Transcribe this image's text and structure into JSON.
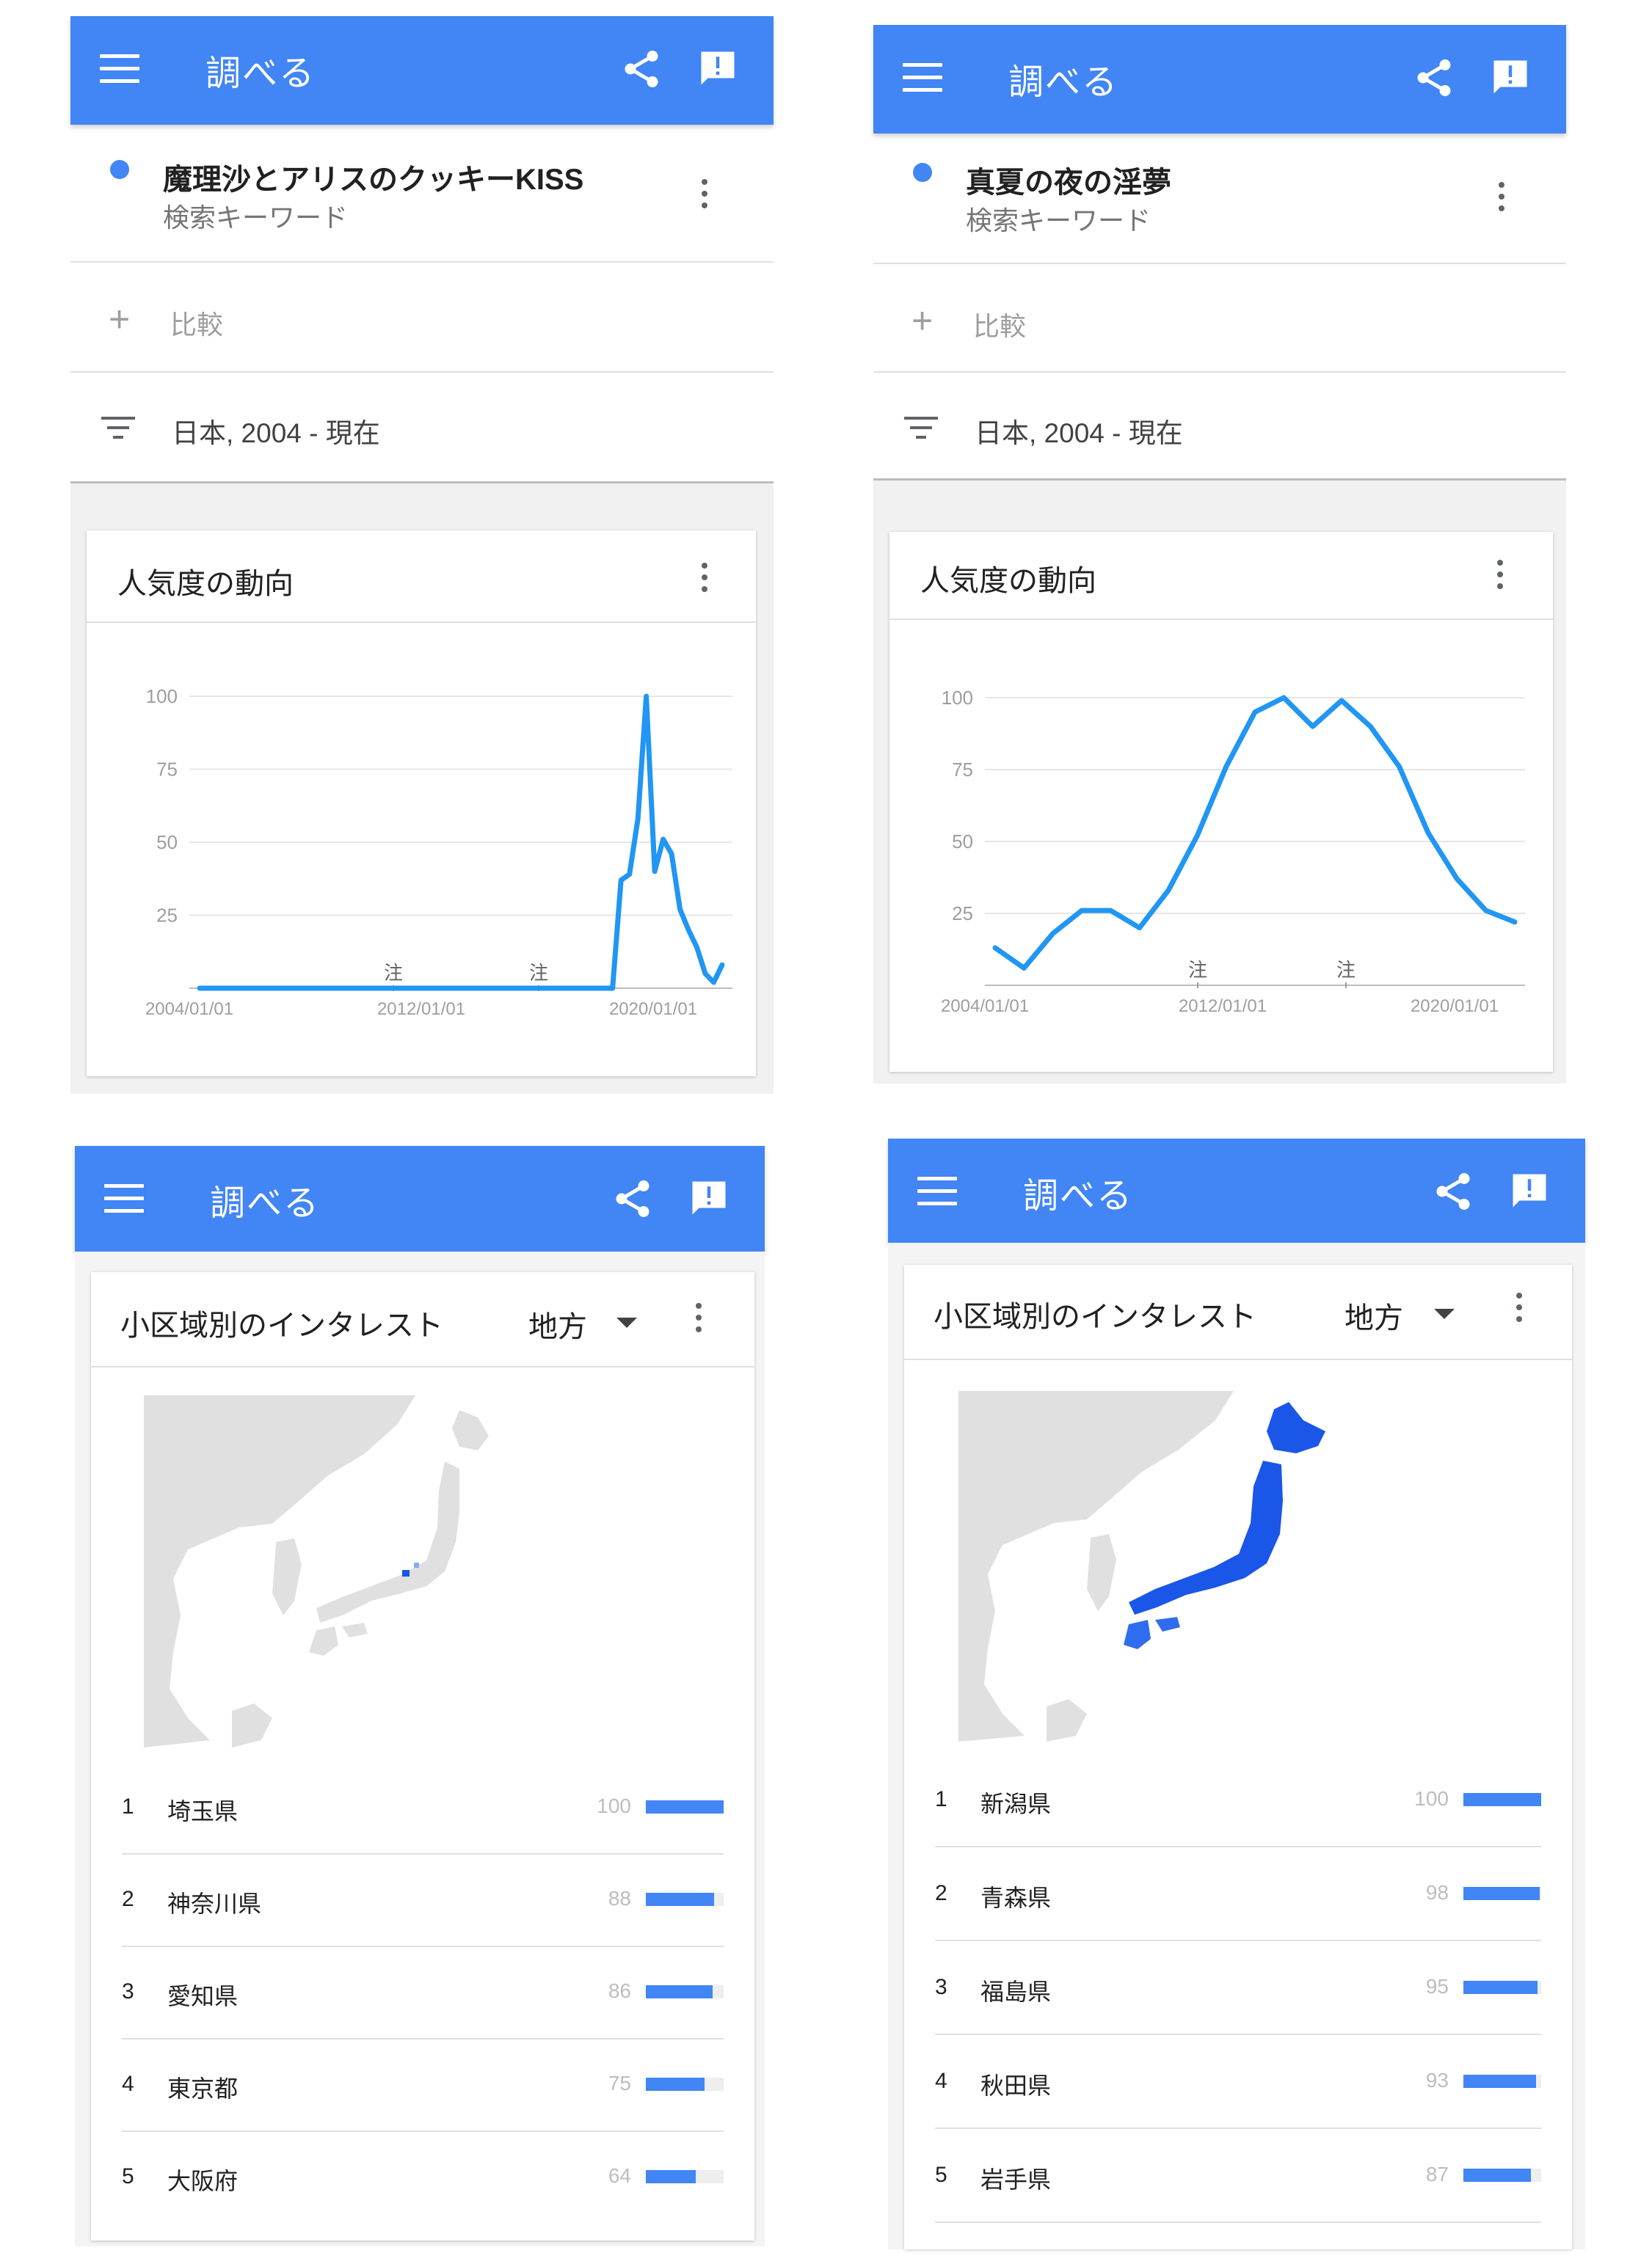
{
  "panels": [
    {
      "appbar": {
        "title": "調べる",
        "menu_icon": "hamburger-menu-icon",
        "share_icon": "share-icon",
        "feedback_icon": "feedback-icon"
      },
      "term": {
        "name": "魔理沙とアリスのクッキーKISS",
        "subtitle": "検索キーワード"
      },
      "compare_label": "比較",
      "filter_label": "日本, 2004 - 現在",
      "trend_card_title": "人気度の動向",
      "chart_data": {
        "type": "line",
        "x_tick_labels": [
          "2004/01/01",
          "2012/01/01",
          "2020/01/01"
        ],
        "y_tick_labels": [
          "100",
          "75",
          "50",
          "25"
        ],
        "ylim": [
          0,
          100
        ],
        "annotations": [
          "注",
          "注"
        ],
        "series": [
          {
            "values": [
              0,
              0,
              0,
              0,
              0,
              0,
              0,
              0,
              0,
              0,
              0,
              0,
              0,
              0,
              0,
              0,
              0,
              0,
              0,
              0,
              0,
              0,
              0,
              0,
              0,
              0,
              0,
              0,
              0,
              0,
              0,
              0,
              0,
              0,
              0,
              0,
              0,
              0,
              0,
              0,
              0,
              0,
              0,
              0,
              0,
              0,
              0,
              0,
              0,
              0,
              37,
              39,
              58,
              100,
              40,
              51,
              46,
              27,
              20,
              14,
              5,
              2,
              8
            ]
          }
        ]
      }
    },
    {
      "appbar": {
        "title": "調べる",
        "menu_icon": "hamburger-menu-icon",
        "share_icon": "share-icon",
        "feedback_icon": "feedback-icon"
      },
      "term": {
        "name": "真夏の夜の淫夢",
        "subtitle": "検索キーワード"
      },
      "compare_label": "比較",
      "filter_label": "日本, 2004 - 現在",
      "trend_card_title": "人気度の動向",
      "chart_data": {
        "type": "line",
        "x_tick_labels": [
          "2004/01/01",
          "2012/01/01",
          "2020/01/01"
        ],
        "y_tick_labels": [
          "100",
          "75",
          "50",
          "25"
        ],
        "ylim": [
          0,
          100
        ],
        "annotations": [
          "注",
          "注"
        ],
        "series": [
          {
            "values": [
              13,
              6,
              18,
              26,
              26,
              20,
              33,
              52,
              76,
              95,
              100,
              90,
              99,
              90,
              76,
              53,
              37,
              26,
              22
            ]
          }
        ]
      }
    },
    {
      "appbar": {
        "title": "調べる",
        "menu_icon": "hamburger-menu-icon",
        "share_icon": "share-icon",
        "feedback_icon": "feedback-icon"
      },
      "region_card_title": "小区域別のインタレスト",
      "resolution_label": "地方",
      "regions": [
        {
          "rank": "1",
          "name": "埼玉県",
          "value": "100",
          "fraction": 1.0
        },
        {
          "rank": "2",
          "name": "神奈川県",
          "value": "88",
          "fraction": 0.88
        },
        {
          "rank": "3",
          "name": "愛知県",
          "value": "86",
          "fraction": 0.86
        },
        {
          "rank": "4",
          "name": "東京都",
          "value": "75",
          "fraction": 0.75
        },
        {
          "rank": "5",
          "name": "大阪府",
          "value": "64",
          "fraction": 0.64
        }
      ]
    },
    {
      "appbar": {
        "title": "調べる",
        "menu_icon": "hamburger-menu-icon",
        "share_icon": "share-icon",
        "feedback_icon": "feedback-icon"
      },
      "region_card_title": "小区域別のインタレスト",
      "resolution_label": "地方",
      "regions": [
        {
          "rank": "1",
          "name": "新潟県",
          "value": "100",
          "fraction": 1.0
        },
        {
          "rank": "2",
          "name": "青森県",
          "value": "98",
          "fraction": 0.98
        },
        {
          "rank": "3",
          "name": "福島県",
          "value": "95",
          "fraction": 0.95
        },
        {
          "rank": "4",
          "name": "秋田県",
          "value": "93",
          "fraction": 0.93
        },
        {
          "rank": "5",
          "name": "岩手県",
          "value": "87",
          "fraction": 0.87
        }
      ]
    }
  ],
  "colors": {
    "appbar": "#4285f4",
    "series": "#2196f3",
    "map_land": "#e0e0e0",
    "map_highlight": "#1a56e8"
  }
}
